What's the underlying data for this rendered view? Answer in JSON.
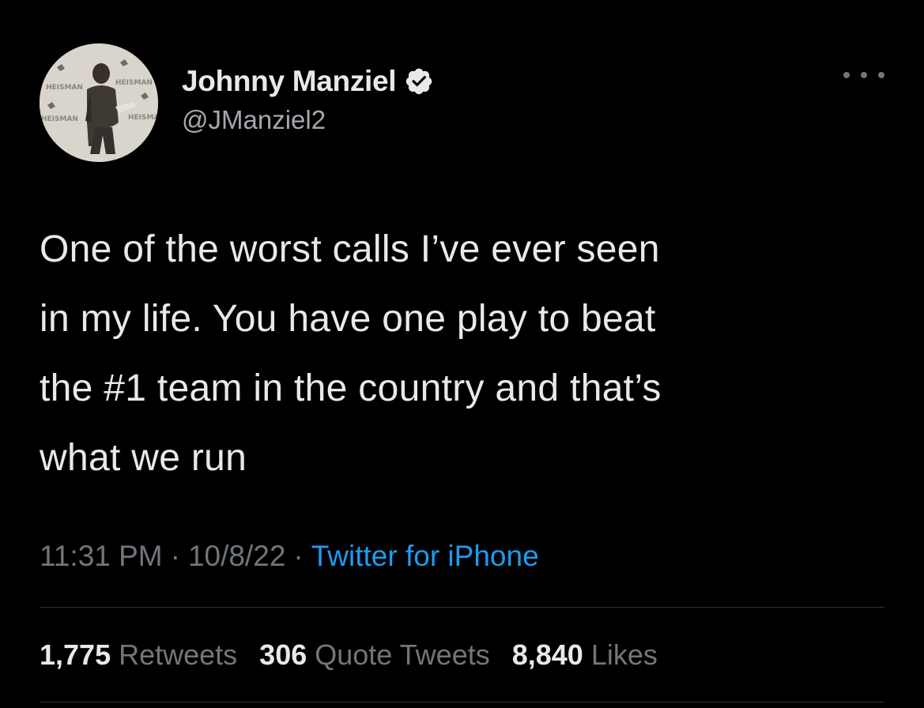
{
  "user": {
    "display_name": "Johnny Manziel",
    "handle": "@JManziel2",
    "verified": true,
    "avatar_backdrop_text": "HEISMAN"
  },
  "tweet": {
    "text": "One of the worst calls I’ve ever seen\nin my life. You have one play to beat\nthe #1 team in the country and that’s\nwhat we run",
    "time": "11:31 PM",
    "date": "10/8/22",
    "separator": "·",
    "source": "Twitter for iPhone"
  },
  "stats": {
    "retweets_count": "1,775",
    "retweets_label": "Retweets",
    "quotes_count": "306",
    "quotes_label": "Quote Tweets",
    "likes_count": "8,840",
    "likes_label": "Likes"
  },
  "colors": {
    "background": "#000000",
    "primary_text": "#e7e9ea",
    "secondary_text": "#71767b",
    "link": "#1d9bf0",
    "divider": "#2f3336"
  },
  "icons": {
    "verified": "verified-badge-icon",
    "more": "more-options-icon"
  }
}
